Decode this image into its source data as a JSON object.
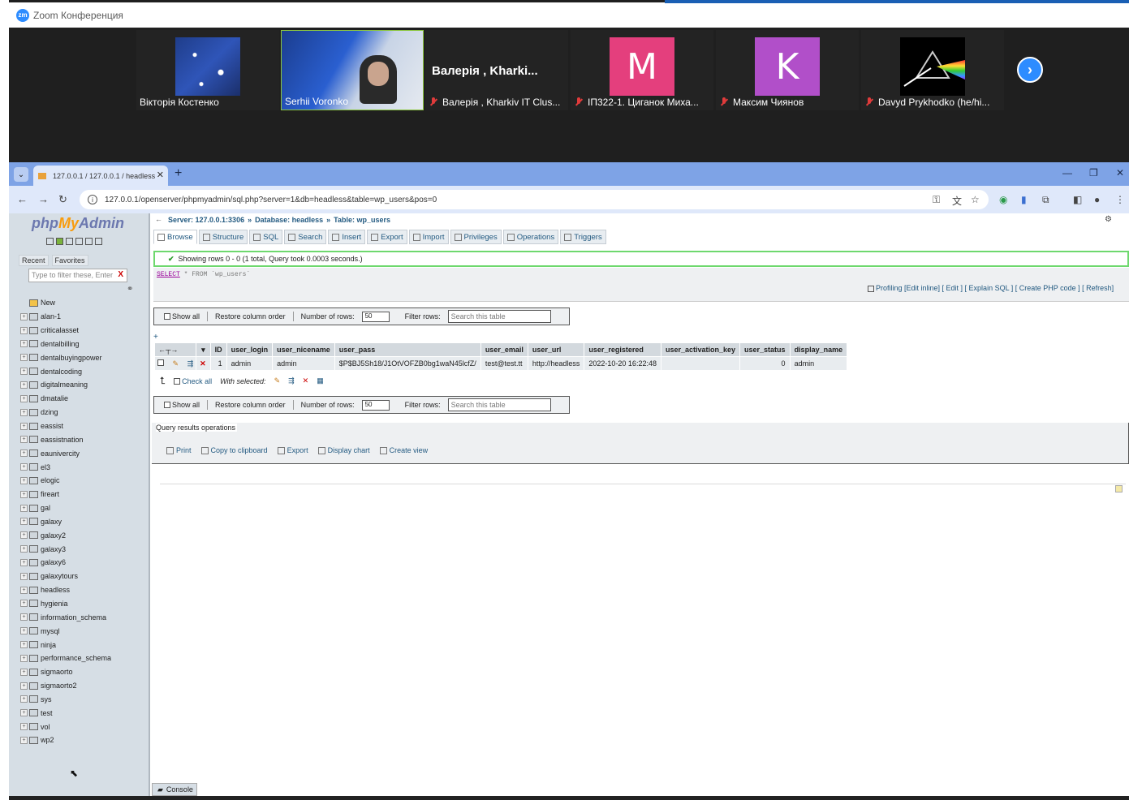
{
  "zoom": {
    "title": "Zoom Конференция",
    "logo": "zm",
    "participants": [
      {
        "name": "Віктopія Костенко",
        "muted": false,
        "kind": "image"
      },
      {
        "name": "Serhii Voronko",
        "muted": false,
        "kind": "video"
      },
      {
        "name": "Валерія , Kharkiv IT Clus...",
        "banner": "Валерія , Kharki...",
        "muted": true,
        "kind": "name"
      },
      {
        "name": "ІП322-1. Циганок Миха...",
        "initial": "M",
        "color": "#e43f7d",
        "muted": true,
        "kind": "avatar"
      },
      {
        "name": "Максим Чиянов",
        "initial": "K",
        "color": "#b14fc9",
        "muted": true,
        "kind": "avatar"
      },
      {
        "name": "Davyd Prykhodko (he/hi...",
        "muted": true,
        "kind": "prism"
      }
    ],
    "next_icon": "chevron-right-icon"
  },
  "browser": {
    "tab_title": "127.0.0.1 / 127.0.0.1 / headless",
    "url": "127.0.0.1/openserver/phpmyadmin/sql.php?server=1&db=headless&table=wp_users&pos=0"
  },
  "pma": {
    "logo_php": "php",
    "logo_my": "My",
    "logo_admin": "Admin",
    "recent": "Recent",
    "favorites": "Favorites",
    "filter_placeholder": "Type to filter these, Enter",
    "filter_clear": "X",
    "databases": [
      "New",
      "alan-1",
      "criticalasset",
      "dentalbilling",
      "dentalbuyingpower",
      "dentalcoding",
      "digitalmeaning",
      "dmatalie",
      "dzing",
      "eassist",
      "eassistnation",
      "eaunivercity",
      "el3",
      "elogic",
      "fireart",
      "gal",
      "galaxy",
      "galaxy2",
      "galaxy3",
      "galaxy6",
      "galaxytours",
      "headless",
      "hygienia",
      "information_schema",
      "mysql",
      "ninja",
      "performance_schema",
      "sigmaorto",
      "sigmaorto2",
      "sys",
      "test",
      "vol",
      "wp2"
    ],
    "breadcrumb": {
      "server": "Server: 127.0.0.1:3306",
      "database": "Database: headless",
      "table": "Table: wp_users"
    },
    "tabs": [
      "Browse",
      "Structure",
      "SQL",
      "Search",
      "Insert",
      "Export",
      "Import",
      "Privileges",
      "Operations",
      "Triggers"
    ],
    "success_msg": "Showing rows 0 - 0 (1 total, Query took 0.0003 seconds.)",
    "sql_select": "SELECT",
    "sql_rest": " * FROM `wp_users`",
    "sql_actions": "Profiling [Edit inline] [ Edit ] [ Explain SQL ] [ Create PHP code ] [ Refresh]",
    "show_all": "Show all",
    "restore_col": "Restore column order",
    "num_rows_label": "Number of rows:",
    "num_rows_value": "50",
    "filter_rows_label": "Filter rows:",
    "filter_rows_placeholder": "Search this table",
    "plus": "+",
    "columns": [
      "ID",
      "user_login",
      "user_nicename",
      "user_pass",
      "user_email",
      "user_url",
      "user_registered",
      "user_activation_key",
      "user_status",
      "display_name"
    ],
    "row": [
      "1",
      "admin",
      "admin",
      "$P$BJ5Sh18/J1OtVOFZB0bg1waN45lcfZ/",
      "test@test.tt",
      "http://headless",
      "2022-10-20 16:22:48",
      "",
      "0",
      "admin"
    ],
    "check_all": "Check all",
    "with_selected": "With selected:",
    "qro_title": "Query results operations",
    "qro_links": [
      "Print",
      "Copy to clipboard",
      "Export",
      "Display chart",
      "Create view"
    ],
    "console": "Console"
  }
}
